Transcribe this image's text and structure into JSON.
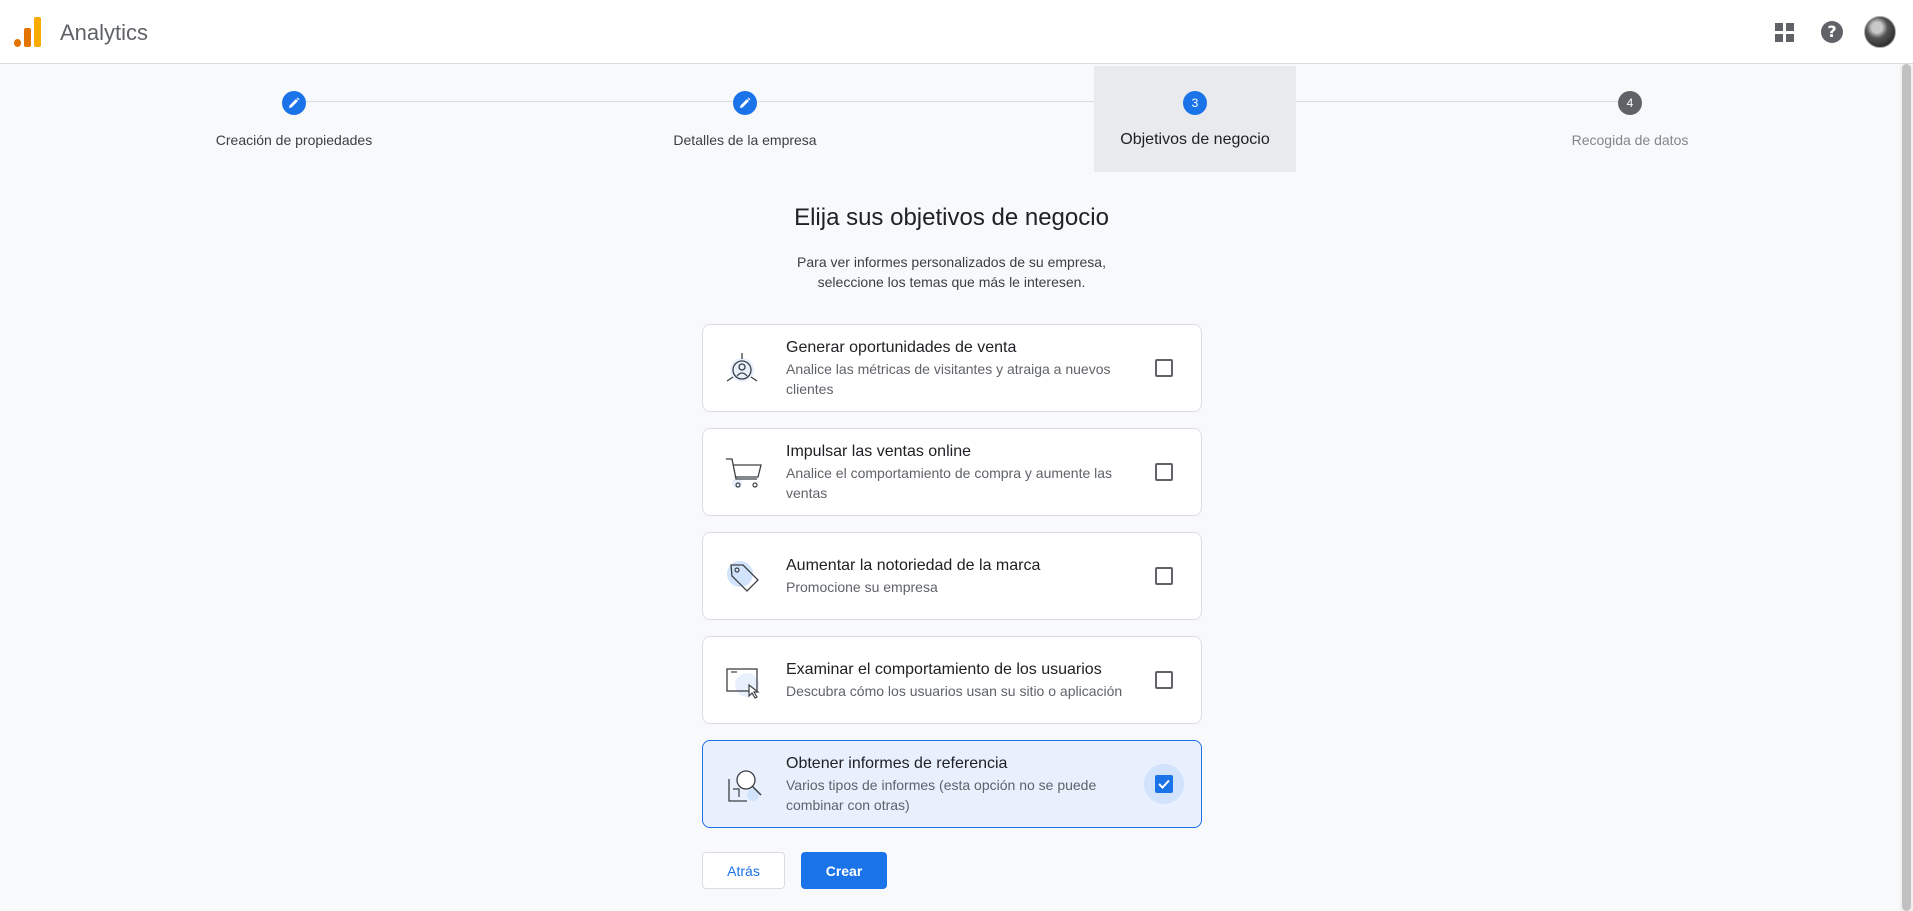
{
  "header": {
    "app_title": "Analytics",
    "icons": [
      "analytics-logo",
      "apps-grid-icon",
      "help-icon",
      "avatar"
    ]
  },
  "stepper": {
    "steps": [
      {
        "number": "1",
        "label": "Creación de propiedades",
        "state": "done"
      },
      {
        "number": "2",
        "label": "Detalles de la empresa",
        "state": "done"
      },
      {
        "number": "3",
        "label": "Objetivos de negocio",
        "state": "current"
      },
      {
        "number": "4",
        "label": "Recogida de datos",
        "state": "todo"
      }
    ]
  },
  "main": {
    "title": "Elija sus objetivos de negocio",
    "subtitle_line1": "Para ver informes personalizados de su empresa,",
    "subtitle_line2": "seleccione los temas que más le interesen."
  },
  "options": [
    {
      "title": "Generar oportunidades de venta",
      "desc": "Analice las métricas de visitantes y atraiga a nuevos clientes",
      "icon": "leads-icon",
      "checked": false
    },
    {
      "title": "Impulsar las ventas online",
      "desc": "Analice el comportamiento de compra y aumente las ventas",
      "icon": "cart-icon",
      "checked": false
    },
    {
      "title": "Aumentar la notoriedad de la marca",
      "desc": "Promocione su empresa",
      "icon": "tag-icon",
      "checked": false
    },
    {
      "title": "Examinar el comportamiento de los usuarios",
      "desc": "Descubra cómo los usuarios usan su sitio o aplicación",
      "icon": "screen-cursor-icon",
      "checked": false
    },
    {
      "title": "Obtener informes de referencia",
      "desc": "Varios tipos de informes (esta opción no se puede combinar con otras)",
      "icon": "magnifier-report-icon",
      "checked": true
    }
  ],
  "actions": {
    "back_label": "Atrás",
    "create_label": "Crear"
  },
  "colors": {
    "accent": "#1a73e8",
    "selected_bg": "#e8f0fe",
    "logo_orange": "#f9ab00"
  }
}
